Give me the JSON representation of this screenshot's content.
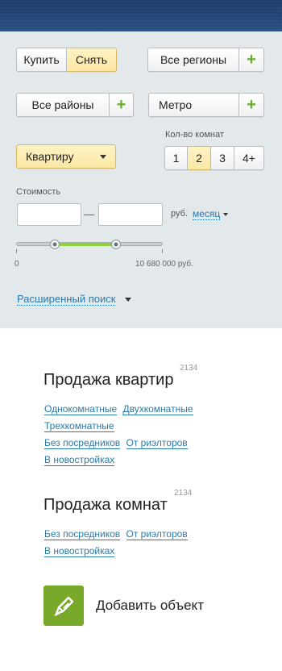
{
  "deal": {
    "buy_label": "Купить",
    "rent_label": "Снять",
    "active": "rent"
  },
  "region": {
    "label": "Все регионы",
    "add": "+"
  },
  "district": {
    "label": "Все районы",
    "add": "+"
  },
  "metro": {
    "label": "Метро",
    "add": "+"
  },
  "property_type": {
    "label": "Квартиру"
  },
  "rooms": {
    "label": "Кол-во комнат",
    "options": [
      "1",
      "2",
      "3",
      "4+"
    ],
    "selected": "2"
  },
  "price": {
    "label": "Стоимость",
    "from_value": "",
    "to_value": "",
    "dash": "—",
    "currency": "руб.",
    "period": "месяц",
    "min_label": "0",
    "max_label": "10 680 000 руб.",
    "range_fraction": [
      0.26,
      0.68
    ]
  },
  "advanced_search": "Расширенный поиск",
  "sale_flats": {
    "count": "2134",
    "title": "Продажа квартир",
    "links": [
      "Однокомнатные",
      "Двухкомнатные",
      "Трехкомнатные",
      "Без посредников",
      "От риэлторов",
      "В новостройках"
    ]
  },
  "sale_rooms": {
    "count": "2134",
    "title": "Продажа комнат",
    "links": [
      "Без посредников",
      "От риэлторов",
      "В новостройках"
    ]
  },
  "add_object": {
    "label": "Добавить объект",
    "icon": "pencil-icon"
  },
  "colors": {
    "accent_green": "#79a92a",
    "active_yellow": "#fbe7a4",
    "link_blue": "#2a7aa8",
    "header_blue": "#244874"
  }
}
